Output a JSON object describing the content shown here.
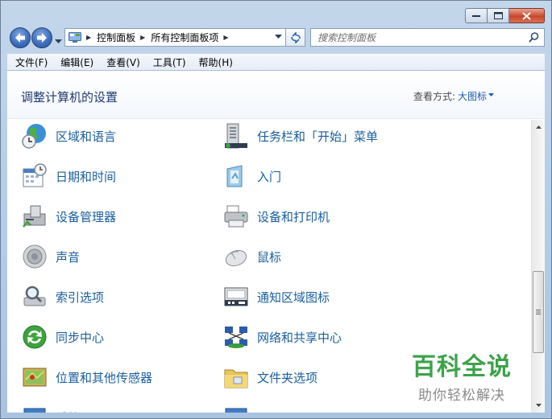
{
  "address": {
    "crumbs": [
      "控制面板",
      "所有控制面板项"
    ]
  },
  "search": {
    "placeholder": "搜索控制面板"
  },
  "menu": [
    "文件(F)",
    "编辑(E)",
    "查看(V)",
    "工具(T)",
    "帮助(H)"
  ],
  "header": {
    "title": "调整计算机的设置",
    "view_label": "查看方式:",
    "view_value": "大图标"
  },
  "items": {
    "left": [
      "区域和语言",
      "日期和时间",
      "设备管理器",
      "声音",
      "索引选项",
      "同步中心",
      "位置和其他传感器",
      "系统"
    ],
    "right": [
      "任务栏和「开始」菜单",
      "入门",
      "设备和打印机",
      "鼠标",
      "通知区域图标",
      "网络和共享中心",
      "文件夹选项",
      "显示"
    ]
  },
  "watermark": {
    "title": "百科全说",
    "subtitle": "助你轻松解决"
  },
  "colors": {
    "link": "#1a5e9c",
    "title": "#1e3a6e",
    "accent": "#3ea24b"
  }
}
